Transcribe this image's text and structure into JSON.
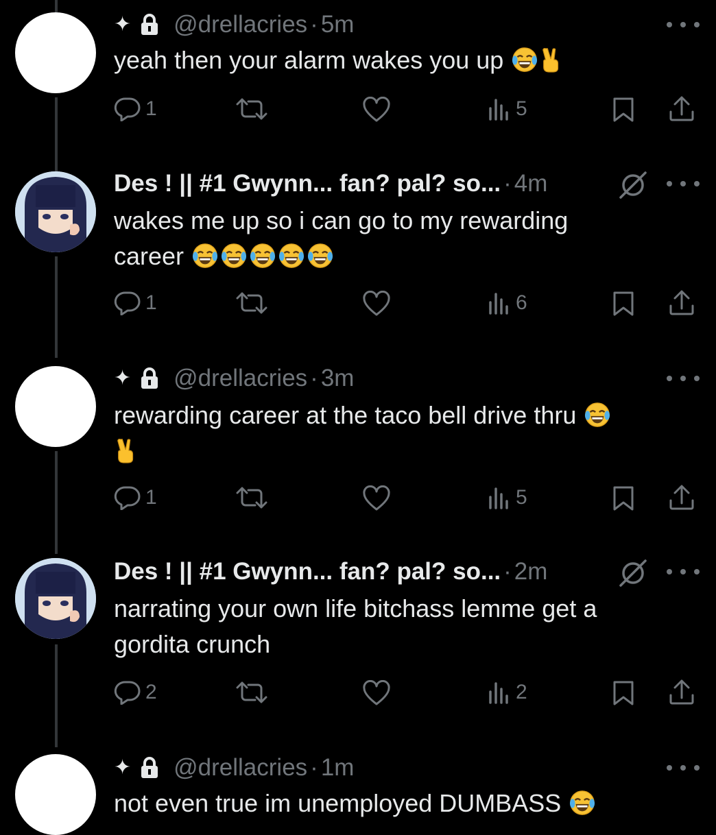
{
  "thread": [
    {
      "author_type": "handle",
      "handle": "@drellacries",
      "separator": "·",
      "time": "5m",
      "text": "yeah then your alarm wakes you up",
      "text_cont": "",
      "emojis": [
        "face-with-tears-of-joy",
        "victory-hand"
      ],
      "stats": {
        "replies": "1",
        "views": "5"
      }
    },
    {
      "author_type": "display-name",
      "name": "Des ! || #1 Gwynn... fan? pal? so...",
      "separator": "·",
      "time": "4m",
      "text": "wakes me up so i can go to my rewarding",
      "text_cont": "career",
      "emojis": [
        "face-with-tears-of-joy",
        "face-with-tears-of-joy",
        "face-with-tears-of-joy",
        "face-with-tears-of-joy",
        "face-with-tears-of-joy"
      ],
      "stats": {
        "replies": "1",
        "views": "6"
      }
    },
    {
      "author_type": "handle",
      "handle": "@drellacries",
      "separator": "·",
      "time": "3m",
      "text": "rewarding career at the taco bell drive thru",
      "text_cont": "",
      "emojis": [
        "face-with-tears-of-joy",
        "victory-hand"
      ],
      "stats": {
        "replies": "1",
        "views": "5"
      }
    },
    {
      "author_type": "display-name",
      "name": "Des ! || #1 Gwynn... fan? pal? so...",
      "separator": "·",
      "time": "2m",
      "text": "narrating your own life bitchass lemme get a",
      "text_cont": "gordita crunch",
      "emojis": [],
      "stats": {
        "replies": "2",
        "views": "2"
      }
    },
    {
      "author_type": "handle",
      "handle": "@drellacries",
      "separator": "·",
      "time": "1m",
      "text": "not even true im unemployed DUMBASS",
      "text_cont": "",
      "emojis": [
        "face-with-tears-of-joy"
      ]
    }
  ],
  "colors": {
    "background": "#000000",
    "text": "#e7e9ea",
    "muted": "#71767b",
    "thread_line": "#333639"
  },
  "icons": [
    "sparkle-icon",
    "lock-icon",
    "more-icon",
    "no-archive-icon",
    "reply-icon",
    "repost-icon",
    "like-icon",
    "views-icon",
    "bookmark-icon",
    "share-icon"
  ]
}
